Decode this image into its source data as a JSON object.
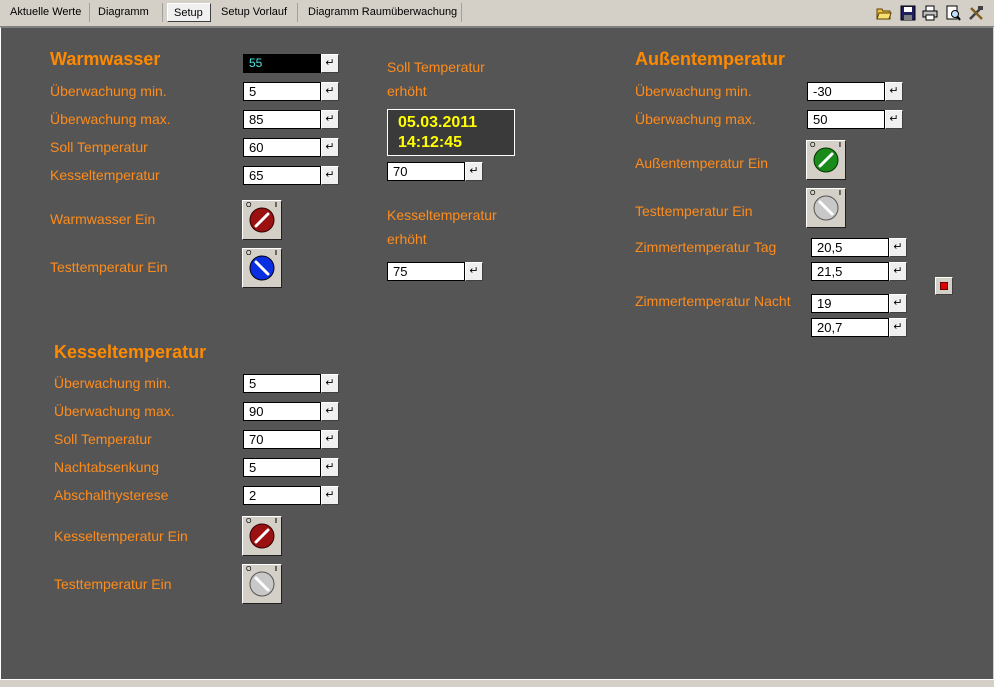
{
  "tabs": [
    {
      "label": "Aktuelle Werte"
    },
    {
      "label": "Diagramm"
    },
    {
      "label": "Setup"
    },
    {
      "label": "Setup Vorlauf"
    },
    {
      "label": "Diagramm Raumüberwachung"
    }
  ],
  "enter_glyph": "↵",
  "knob_marks": {
    "off": "O",
    "on": "I"
  },
  "colors": {
    "red": "#9b1010",
    "blue": "#0a2ee0",
    "green": "#1a8a1a",
    "grey": "#c8c8c8",
    "label": "#ff8c1a",
    "background": "#555555"
  },
  "warmwasser": {
    "title": "Warmwasser",
    "rows": [
      {
        "label": "",
        "value": "55"
      },
      {
        "label": "Überwachung min.",
        "value": "5"
      },
      {
        "label": "Überwachung max.",
        "value": "85"
      },
      {
        "label": "Soll Temperatur",
        "value": "60"
      },
      {
        "label": "Kesseltemperatur",
        "value": "65"
      }
    ],
    "switch_on_label": "Warmwasser Ein",
    "test_label": "Testtemperatur Ein"
  },
  "middle": {
    "soll_label_1": "Soll Temperatur",
    "soll_label_2": "erhöht",
    "date": "05.03.2011",
    "time": "14:12:45",
    "soll_value": "70",
    "kessel_label_1": "Kesseltemperatur",
    "kessel_label_2": "erhöht",
    "kessel_value": "75"
  },
  "kessel": {
    "title": "Kesseltemperatur",
    "rows": [
      {
        "label": "Überwachung min.",
        "value": "5"
      },
      {
        "label": "Überwachung max.",
        "value": "90"
      },
      {
        "label": "Soll Temperatur",
        "value": "70"
      },
      {
        "label": "Nachtabsenkung",
        "value": "5"
      },
      {
        "label": "Abschalthysterese",
        "value": "2"
      }
    ],
    "switch_on_label": "Kesseltemperatur Ein",
    "test_label": "Testtemperatur Ein"
  },
  "aussen": {
    "title": "Außentemperatur",
    "min_label": "Überwachung min.",
    "min_value": "-30",
    "max_label": "Überwachung max.",
    "max_value": "50",
    "switch_on_label": "Außentemperatur Ein",
    "test_label": "Testtemperatur Ein",
    "tag_label": "Zimmertemperatur Tag",
    "tag_value_1": "20,5",
    "tag_value_2": "21,5",
    "nacht_label": "Zimmertemperatur Nacht",
    "nacht_value_1": "19",
    "nacht_value_2": "20,7"
  }
}
